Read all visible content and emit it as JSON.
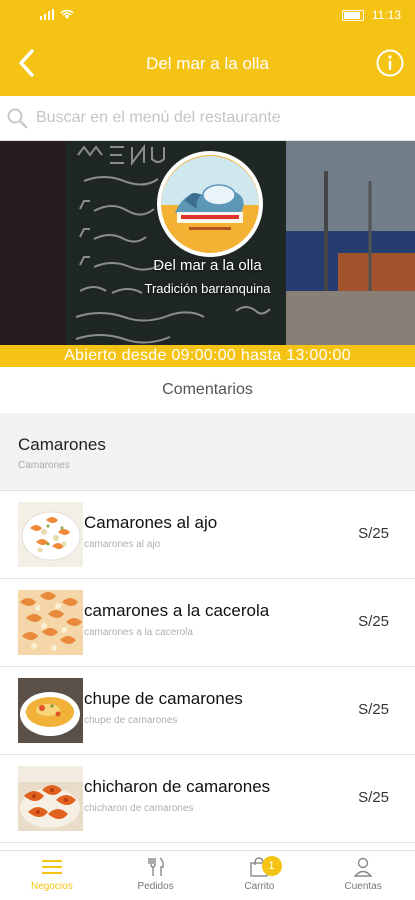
{
  "status_bar": {
    "time": "11:13"
  },
  "header": {
    "title": "Del mar a la olla"
  },
  "search": {
    "placeholder": "Buscar en el menú del restaurante"
  },
  "restaurant": {
    "name": "Del mar a la olla",
    "tagline": "Tradición barranquina",
    "hours": "Abierto desde 09:00:00 hasta 13:00:00",
    "logo_text": "Del mar a la olla"
  },
  "comments_label": "Comentarios",
  "section": {
    "title": "Camarones",
    "subtitle": "Camarones"
  },
  "menu_items": [
    {
      "name": "Camarones al ajo",
      "description": "camarones al ajo",
      "price": "S/25"
    },
    {
      "name": "camarones a la cacerola",
      "description": "camarones a la cacerola",
      "price": "S/25"
    },
    {
      "name": "chupe de camarones",
      "description": "chupe de camarones",
      "price": "S/25"
    },
    {
      "name": "chicharon de camarones",
      "description": "chicharon de camarones",
      "price": "S/25"
    }
  ],
  "bottom_nav": [
    {
      "label": "Negocios",
      "icon": "list-icon",
      "active": true
    },
    {
      "label": "Pedidos",
      "icon": "fork-knife-icon",
      "active": false
    },
    {
      "label": "Carrito",
      "icon": "shopping-bag-icon",
      "active": false,
      "badge": "1"
    },
    {
      "label": "Cuentas",
      "icon": "user-icon",
      "active": false
    }
  ],
  "colors": {
    "accent": "#f5c314",
    "background": "#ffffff",
    "section_bg": "#f2f2f2"
  }
}
